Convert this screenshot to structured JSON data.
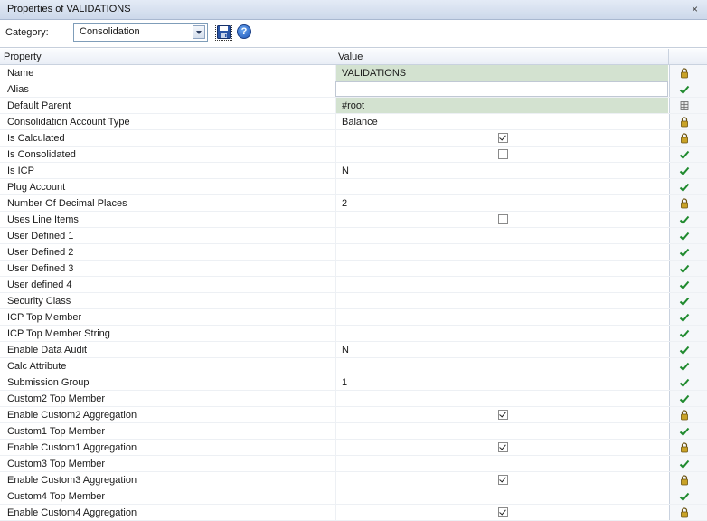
{
  "window": {
    "title": "Properties of VALIDATIONS",
    "close_label": "×"
  },
  "toolbar": {
    "category_label": "Category:",
    "category_value": "Consolidation",
    "save_icon": "save-icon",
    "help_icon": "help-icon",
    "help_glyph": "?"
  },
  "grid": {
    "columns": [
      "Property",
      "Value"
    ],
    "rows": [
      {
        "name": "Name",
        "value": "VALIDATIONS",
        "type": "text",
        "style": "shaded",
        "icon": "lock"
      },
      {
        "name": "Alias",
        "value": "",
        "type": "text",
        "style": "bordered",
        "icon": "check"
      },
      {
        "name": "Default Parent",
        "value": "#root",
        "type": "text",
        "style": "shaded",
        "icon": "grid"
      },
      {
        "name": "Consolidation Account Type",
        "value": "Balance",
        "type": "text",
        "style": "",
        "icon": "lock"
      },
      {
        "name": "Is Calculated",
        "value": true,
        "type": "checkbox",
        "style": "",
        "icon": "lock"
      },
      {
        "name": "Is Consolidated",
        "value": false,
        "type": "checkbox",
        "style": "",
        "icon": "check"
      },
      {
        "name": "Is ICP",
        "value": "N",
        "type": "text",
        "style": "",
        "icon": "check"
      },
      {
        "name": "Plug Account",
        "value": "",
        "type": "text",
        "style": "",
        "icon": "check"
      },
      {
        "name": "Number Of Decimal Places",
        "value": "2",
        "type": "text",
        "style": "",
        "icon": "lock"
      },
      {
        "name": "Uses Line Items",
        "value": false,
        "type": "checkbox",
        "style": "",
        "icon": "check"
      },
      {
        "name": "User Defined 1",
        "value": "",
        "type": "text",
        "style": "",
        "icon": "check"
      },
      {
        "name": "User Defined 2",
        "value": "",
        "type": "text",
        "style": "",
        "icon": "check"
      },
      {
        "name": "User Defined 3",
        "value": "",
        "type": "text",
        "style": "",
        "icon": "check"
      },
      {
        "name": "User defined 4",
        "value": "",
        "type": "text",
        "style": "",
        "icon": "check"
      },
      {
        "name": "Security Class",
        "value": "",
        "type": "text",
        "style": "",
        "icon": "check"
      },
      {
        "name": "ICP Top Member",
        "value": "",
        "type": "text",
        "style": "",
        "icon": "check"
      },
      {
        "name": "ICP Top Member String",
        "value": "",
        "type": "text",
        "style": "",
        "icon": "check"
      },
      {
        "name": "Enable Data Audit",
        "value": "N",
        "type": "text",
        "style": "",
        "icon": "check"
      },
      {
        "name": "Calc Attribute",
        "value": "",
        "type": "text",
        "style": "",
        "icon": "check"
      },
      {
        "name": "Submission Group",
        "value": "1",
        "type": "text",
        "style": "",
        "icon": "check"
      },
      {
        "name": "Custom2 Top Member",
        "value": "",
        "type": "text",
        "style": "",
        "icon": "check"
      },
      {
        "name": "Enable Custom2 Aggregation",
        "value": true,
        "type": "checkbox",
        "style": "",
        "icon": "lock"
      },
      {
        "name": "Custom1 Top Member",
        "value": "",
        "type": "text",
        "style": "",
        "icon": "check"
      },
      {
        "name": "Enable Custom1 Aggregation",
        "value": true,
        "type": "checkbox",
        "style": "",
        "icon": "lock"
      },
      {
        "name": "Custom3 Top Member",
        "value": "",
        "type": "text",
        "style": "",
        "icon": "check"
      },
      {
        "name": "Enable Custom3 Aggregation",
        "value": true,
        "type": "checkbox",
        "style": "",
        "icon": "lock"
      },
      {
        "name": "Custom4 Top Member",
        "value": "",
        "type": "text",
        "style": "",
        "icon": "check"
      },
      {
        "name": "Enable Custom4 Aggregation",
        "value": true,
        "type": "checkbox",
        "style": "",
        "icon": "lock"
      }
    ]
  },
  "colors": {
    "shaded_value": "#d3e2d0",
    "check_green": "#1f8a2e",
    "lock_gold": "#c9a227",
    "help_blue": "#1d55b8"
  }
}
